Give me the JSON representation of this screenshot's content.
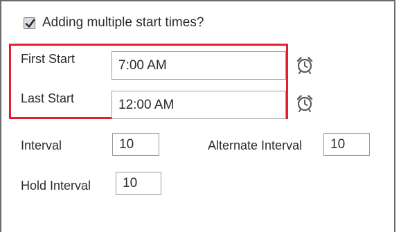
{
  "multi_start": {
    "checked": true,
    "label": "Adding multiple start times?"
  },
  "first_start": {
    "label": "First Start",
    "value": "7:00 AM",
    "icon": "alarm-clock-icon"
  },
  "last_start": {
    "label": "Last Start",
    "value": "12:00 AM",
    "icon": "alarm-clock-icon"
  },
  "interval": {
    "label": "Interval",
    "value": "10"
  },
  "alternate_interval": {
    "label": "Alternate Interval",
    "value": "10"
  },
  "hold_interval": {
    "label": "Hold Interval",
    "value": "10"
  },
  "colors": {
    "highlight": "#e0202e",
    "border": "#9a9a9a"
  }
}
